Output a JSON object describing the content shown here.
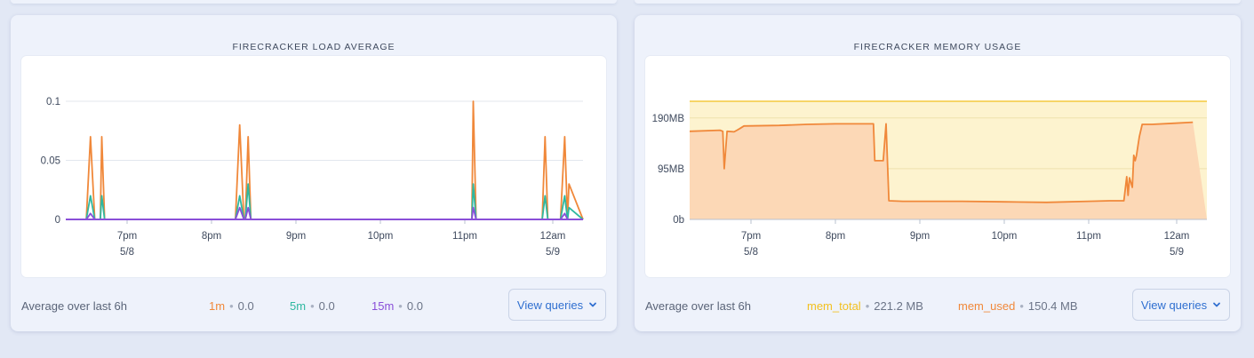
{
  "panels": [
    {
      "title": "FIRECRACKER LOAD AVERAGE",
      "footer_label": "Average over last 6h",
      "legend": [
        {
          "name": "1m",
          "value": "0.0",
          "color": "#f0883a"
        },
        {
          "name": "5m",
          "value": "0.0",
          "color": "#2fb8a0"
        },
        {
          "name": "15m",
          "value": "0.0",
          "color": "#8a4fd8"
        }
      ],
      "button_label": "View queries",
      "button_icon": "chevron-down-icon"
    },
    {
      "title": "FIRECRACKER MEMORY USAGE",
      "footer_label": "Average over last 6h",
      "legend": [
        {
          "name": "mem_total",
          "value": "221.2 MB",
          "color": "#f2c01f"
        },
        {
          "name": "mem_used",
          "value": "150.4 MB",
          "color": "#f0883a"
        }
      ],
      "button_label": "View queries",
      "button_icon": "chevron-down-icon"
    }
  ],
  "chart_data": [
    {
      "type": "line",
      "x_unit": "time",
      "x_ticks": [
        "7pm\n5/8",
        "8pm",
        "9pm",
        "10pm",
        "11pm",
        "12am\n5/9"
      ],
      "y_ticks": [
        "0",
        "0.05",
        "0.1"
      ],
      "ylim": [
        0,
        0.1
      ],
      "grid": true,
      "series": [
        {
          "name": "1m",
          "points": [
            [
              "18:31",
              0
            ],
            [
              "18:34",
              0.07
            ],
            [
              "18:37",
              0
            ],
            [
              "18:41",
              0
            ],
            [
              "18:42",
              0.07
            ],
            [
              "18:44",
              0
            ],
            [
              "20:17",
              0
            ],
            [
              "20:20",
              0.08
            ],
            [
              "20:23",
              0
            ],
            [
              "20:24",
              0
            ],
            [
              "20:26",
              0.07
            ],
            [
              "20:28",
              0
            ],
            [
              "23:05",
              0
            ],
            [
              "23:06",
              0.1
            ],
            [
              "23:08",
              0
            ],
            [
              "23:55",
              0
            ],
            [
              "23:57",
              0.07
            ],
            [
              "23:59",
              0
            ],
            [
              "00:08",
              0
            ],
            [
              "00:11",
              0.07
            ],
            [
              "00:13",
              0
            ],
            [
              "00:14",
              0.03
            ]
          ]
        },
        {
          "name": "5m",
          "points": [
            [
              "18:31",
              0
            ],
            [
              "18:34",
              0.02
            ],
            [
              "18:37",
              0
            ],
            [
              "18:41",
              0
            ],
            [
              "18:42",
              0.02
            ],
            [
              "18:44",
              0
            ],
            [
              "20:17",
              0
            ],
            [
              "20:20",
              0.02
            ],
            [
              "20:23",
              0
            ],
            [
              "20:24",
              0
            ],
            [
              "20:26",
              0.03
            ],
            [
              "20:28",
              0
            ],
            [
              "23:05",
              0
            ],
            [
              "23:06",
              0.03
            ],
            [
              "23:08",
              0
            ],
            [
              "23:55",
              0
            ],
            [
              "23:57",
              0.02
            ],
            [
              "23:59",
              0
            ],
            [
              "00:08",
              0
            ],
            [
              "00:11",
              0.02
            ],
            [
              "00:13",
              0
            ],
            [
              "00:14",
              0.01
            ]
          ]
        },
        {
          "name": "15m",
          "points": [
            [
              "18:31",
              0
            ],
            [
              "18:34",
              0.005
            ],
            [
              "18:37",
              0
            ],
            [
              "20:17",
              0
            ],
            [
              "20:20",
              0.01
            ],
            [
              "20:23",
              0
            ],
            [
              "20:24",
              0
            ],
            [
              "20:26",
              0.01
            ],
            [
              "20:28",
              0
            ],
            [
              "23:05",
              0
            ],
            [
              "23:06",
              0.01
            ],
            [
              "23:08",
              0
            ],
            [
              "00:08",
              0
            ],
            [
              "00:11",
              0.005
            ],
            [
              "00:13",
              0
            ],
            [
              "00:14",
              0
            ]
          ]
        }
      ]
    },
    {
      "type": "area",
      "x_unit": "time",
      "x_ticks": [
        "7pm\n5/8",
        "8pm",
        "9pm",
        "10pm",
        "11pm",
        "12am\n5/9"
      ],
      "y_ticks": [
        "0b",
        "95MB",
        "190MB"
      ],
      "ylim": [
        0,
        221.2
      ],
      "grid": true,
      "series": [
        {
          "name": "mem_total",
          "points": [
            [
              "18:16",
              221.2
            ],
            [
              "00:14",
              221.2
            ]
          ]
        },
        {
          "name": "mem_used",
          "points": [
            [
              "18:16",
              165
            ],
            [
              "18:38",
              167
            ],
            [
              "18:40",
              165
            ],
            [
              "18:41",
              95
            ],
            [
              "18:43",
              165
            ],
            [
              "18:48",
              164
            ],
            [
              "18:50",
              167
            ],
            [
              "18:52",
              170
            ],
            [
              "18:55",
              175
            ],
            [
              "19:20",
              176
            ],
            [
              "19:40",
              178
            ],
            [
              "20:00",
              179
            ],
            [
              "20:27",
              179
            ],
            [
              "20:28",
              110
            ],
            [
              "20:34",
              110
            ],
            [
              "20:36",
              179
            ],
            [
              "20:38",
              35
            ],
            [
              "20:48",
              34
            ],
            [
              "21:30",
              34
            ],
            [
              "22:00",
              33
            ],
            [
              "22:30",
              32
            ],
            [
              "23:00",
              34
            ],
            [
              "23:15",
              35
            ],
            [
              "23:25",
              35
            ],
            [
              "23:27",
              80
            ],
            [
              "23:28",
              45
            ],
            [
              "23:29",
              78
            ],
            [
              "23:31",
              60
            ],
            [
              "23:32",
              120
            ],
            [
              "23:33",
              110
            ],
            [
              "23:34",
              120
            ],
            [
              "23:36",
              155
            ],
            [
              "23:38",
              178
            ],
            [
              "23:45",
              178
            ],
            [
              "00:00",
              180
            ],
            [
              "00:14",
              182
            ]
          ]
        }
      ]
    }
  ]
}
